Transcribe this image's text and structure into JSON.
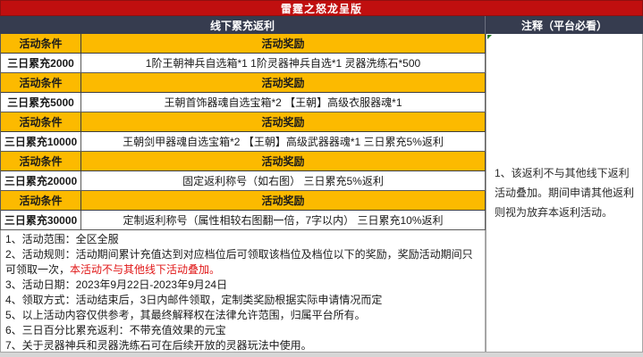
{
  "banner": {
    "title": "雷霆之怒龙呈版"
  },
  "section_headers": {
    "left": "线下累充返利",
    "right": "注释（平台必看）"
  },
  "table": {
    "condition_header": "活动条件",
    "reward_header": "活动奖励",
    "rows": [
      {
        "condition": "三日累充2000",
        "reward": "1阶王朝神兵自选箱*1 1阶灵器神兵自选*1 灵器洗练石*500"
      },
      {
        "condition": "三日累充5000",
        "reward": "王朝首饰器魂自选宝箱*2 【王朝】高级衣服器魂*1"
      },
      {
        "condition": "三日累充10000",
        "reward": "王朝剑甲器魂自选宝箱*2 【王朝】高级武器器魂*1 三日累充5%返利"
      },
      {
        "condition": "三日累充20000",
        "reward": "固定返利称号（如右图） 三日累充5%返利"
      },
      {
        "condition": "三日累充30000",
        "reward": "定制返利称号（属性相较右图翻一倍，7字以内） 三日累充10%返利"
      }
    ]
  },
  "notes": [
    {
      "text": "1、活动范围：全区全服",
      "red": ""
    },
    {
      "text": "2、活动规则：活动期间累计充值达到对应档位后可领取该档位及档位以下的奖励，奖励活动期间只可领取一次，",
      "red": "本活动不与其他线下活动叠加。"
    },
    {
      "text": "3、活动日期：2023年9月22日-2023年9月24日",
      "red": ""
    },
    {
      "text": "4、领取方式：活动结束后，3日内邮件领取，定制类奖励根据实际申请情况而定",
      "red": ""
    },
    {
      "text": "5、以上活动内容仅供参考，其最终解释权在法律允许范围，归属平台所有。",
      "red": ""
    },
    {
      "text": "6、三日百分比累充返利：不带充值效果的元宝",
      "red": ""
    },
    {
      "text": "7、关于灵器神兵和灵器洗练石可在后续开放的灵器玩法中使用。",
      "red": ""
    }
  ],
  "annotation": {
    "text": "1、该返利不与其他线下返利活动叠加。期间申请其他返利则视为放弃本返利活动。"
  },
  "colors": {
    "banner_red": "#c00f0f",
    "header_navy": "#363c4f",
    "row_gold": "#fcba00",
    "alert_red": "#e01616",
    "corner_marker_green": "#1f7a1f"
  }
}
